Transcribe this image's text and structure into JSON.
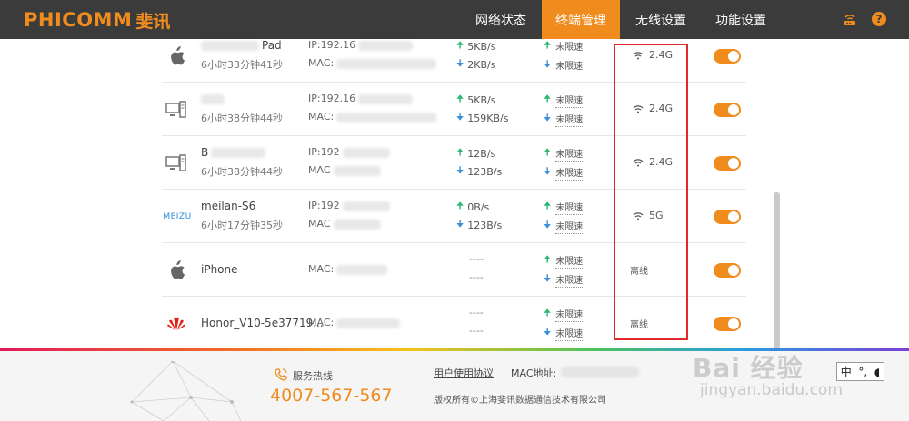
{
  "header": {
    "brand_en": "PHICOMM",
    "brand_cn": "斐讯",
    "nav": [
      "网络状态",
      "终端管理",
      "无线设置",
      "功能设置"
    ],
    "active_nav": "终端管理",
    "icons": [
      "router-icon",
      "help-icon"
    ],
    "help_glyph": "?"
  },
  "devices": [
    {
      "name": "Pad",
      "time": "6小时33分钟41秒",
      "ip_label": "IP:192.16",
      "mac_label": "MAC:",
      "up": "5KB/s",
      "down": "2KB/s",
      "limit_up": "未限速",
      "limit_down": "未限速",
      "band": "2.4G",
      "icon": "apple-icon"
    },
    {
      "name": "",
      "time": "6小时38分钟44秒",
      "ip_label": "IP:192.16",
      "mac_label": "MAC:",
      "up": "5KB/s",
      "down": "159KB/s",
      "limit_up": "未限速",
      "limit_down": "未限速",
      "band": "2.4G",
      "icon": "computer-icon"
    },
    {
      "name": "B",
      "time": "6小时38分钟44秒",
      "ip_label": "IP:192",
      "mac_label": "MAC",
      "up": "12B/s",
      "down": "123B/s",
      "limit_up": "未限速",
      "limit_down": "未限速",
      "band": "2.4G",
      "icon": "computer-icon"
    },
    {
      "name": "meilan-S6",
      "time": "6小时17分钟35秒",
      "ip_label": "IP:192",
      "mac_label": "MAC",
      "up": "0B/s",
      "down": "123B/s",
      "limit_up": "未限速",
      "limit_down": "未限速",
      "band": "5G",
      "icon": "meizu-logo"
    },
    {
      "name": "iPhone",
      "mac_label": "MAC:",
      "up": "----",
      "down": "----",
      "limit_up": "未限速",
      "limit_down": "未限速",
      "status": "离线",
      "icon": "apple-icon"
    },
    {
      "name": "Honor_V10-5e37719...",
      "mac_label": "MAC:",
      "up": "----",
      "down": "----",
      "limit_up": "未限速",
      "limit_down": "未限速",
      "status": "离线",
      "icon": "huawei-icon"
    }
  ],
  "meizu_text": "MEIZU",
  "footer": {
    "hotline_label": "服务热线",
    "hotline": "4007-567-567",
    "agreement": "用户使用协议",
    "mac_label": "MAC地址:",
    "copyright": "版权所有©上海斐讯数据通信技术有限公司"
  },
  "watermark": {
    "logo": "Bai 经验",
    "url": "jingyan.baidu.com"
  },
  "ime": {
    "mode": "中",
    "punct": "°,"
  },
  "colors": {
    "accent": "#f08c1e",
    "header_bg": "#3b3b3b",
    "highlight": "#e0282e",
    "up_arrow": "#2bb673",
    "down_arrow": "#3a8fd9"
  }
}
